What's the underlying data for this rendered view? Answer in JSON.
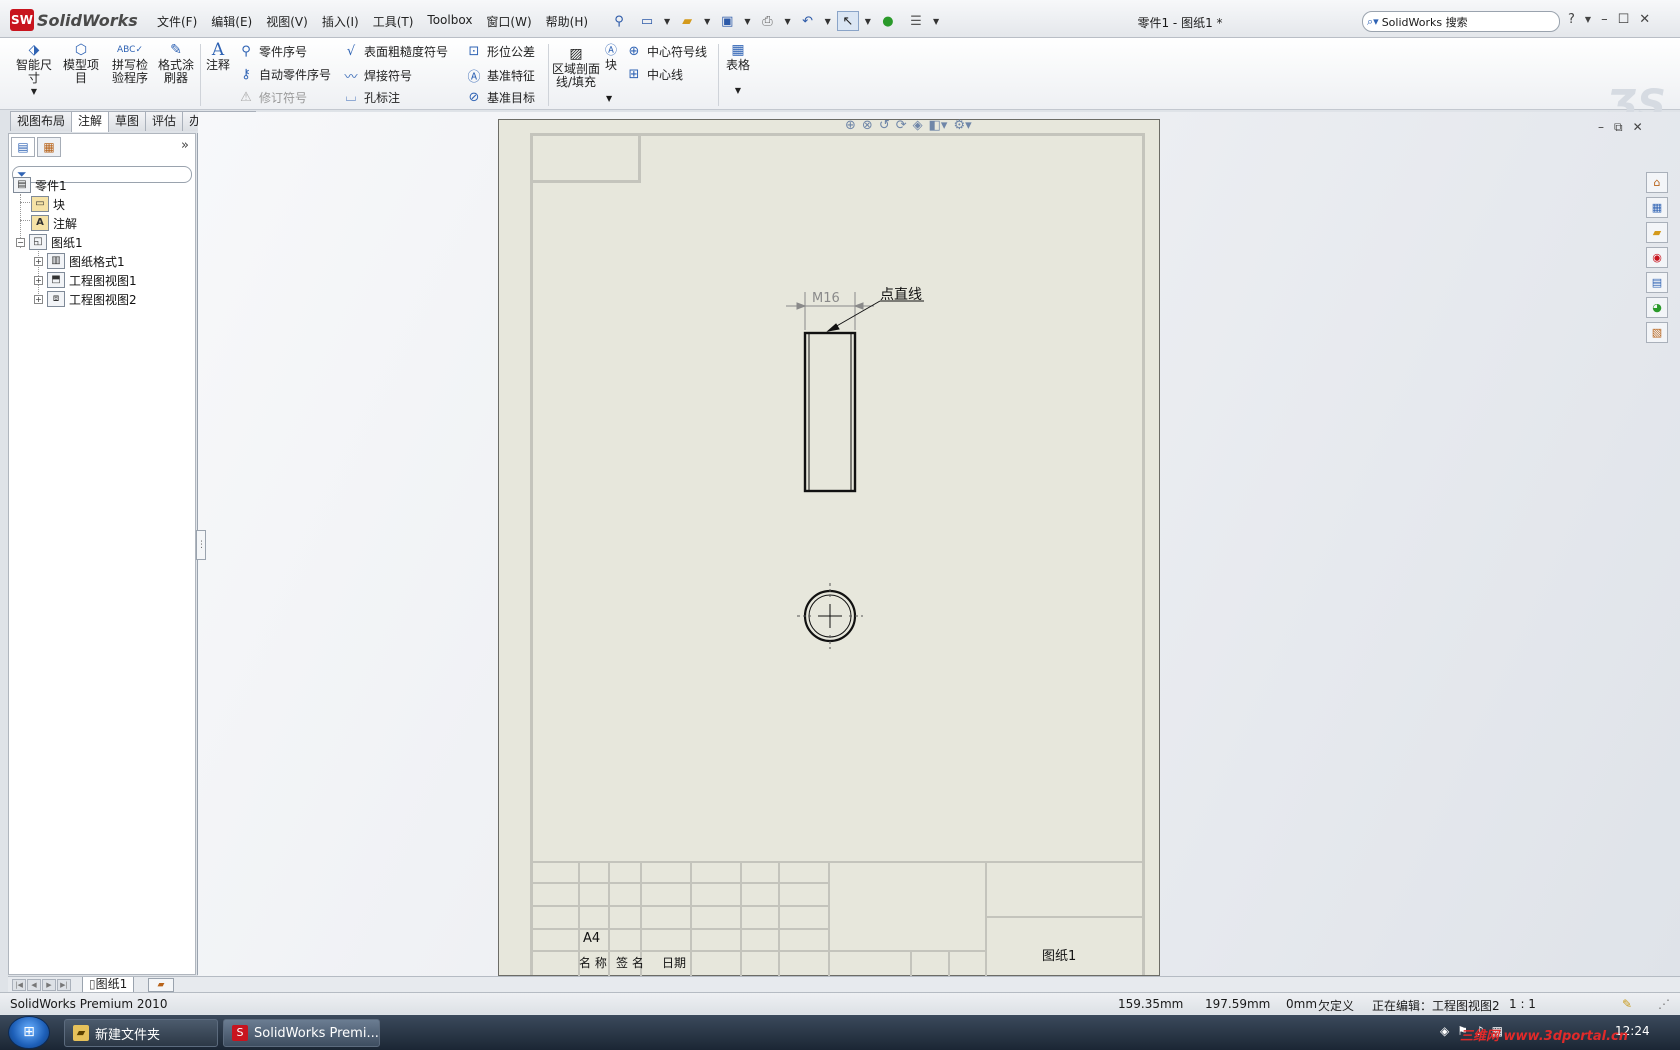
{
  "app": {
    "logo_text": "SolidWorks",
    "logo_badge": "SW",
    "document_title": "零件1 - 图纸1 *"
  },
  "menu": [
    "文件(F)",
    "编辑(E)",
    "视图(V)",
    "插入(I)",
    "工具(T)",
    "Toolbox",
    "窗口(W)",
    "帮助(H)"
  ],
  "search": {
    "placeholder": "SolidWorks 搜索"
  },
  "command_manager": {
    "smart_dim": "智能尺寸",
    "model_items": "模型项目",
    "spell_check": "拼写检验程序",
    "format_painter": "格式涂刷器",
    "note": "注释",
    "balloon": "零件序号",
    "auto_balloon": "自动零件序号",
    "revision_symbol": "修订符号",
    "surface_finish": "表面粗糙度符号",
    "weld_symbol": "焊接符号",
    "hole_callout": "孔标注",
    "gtol": "形位公差",
    "datum_feature": "基准特征",
    "datum_target": "基准目标",
    "area_hatch": "区域剖面线/填充",
    "block": "块",
    "center_mark": "中心符号线",
    "centerline": "中心线",
    "table": "表格"
  },
  "tabs": [
    {
      "label": "视图布局",
      "active": false
    },
    {
      "label": "注解",
      "active": true
    },
    {
      "label": "草图",
      "active": false
    },
    {
      "label": "评估",
      "active": false
    },
    {
      "label": "办公室产品",
      "active": false
    }
  ],
  "tree": {
    "root": "零件1",
    "items": [
      "块",
      "注解",
      "图纸1",
      "图纸格式1",
      "工程图视图1",
      "工程图视图2"
    ]
  },
  "drawing": {
    "dimension_text": "M16",
    "leader_note": "点直线",
    "paper_size": "A4",
    "tb_name": "名 称",
    "tb_sign": "签 名",
    "tb_date": "日期",
    "sheet_name_cell": "图纸1"
  },
  "sheet_tab": "图纸1",
  "status": {
    "product": "SolidWorks Premium 2010",
    "x": "159.35mm",
    "y": "197.59mm",
    "z": "0mm",
    "define_state": "欠定义",
    "editing": "正在编辑：工程图视图2",
    "scale": "1 : 1"
  },
  "taskbar": {
    "item1": "新建文件夹",
    "item2": "SolidWorks Premi...",
    "clock": "12:24"
  },
  "watermark": "三维网 www.3dportal.cn",
  "colors": {
    "sheet_bg": "#e7e7dc",
    "accent_red": "#c8141e",
    "icon_blue": "#2f63b4"
  }
}
